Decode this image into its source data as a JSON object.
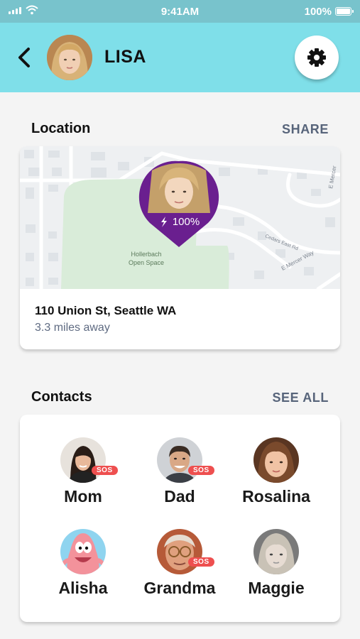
{
  "status_bar": {
    "time": "9:41AM",
    "battery": "100%"
  },
  "header": {
    "name": "LISA",
    "back_icon": "chevron-left-icon",
    "settings_icon": "gear-icon"
  },
  "location": {
    "title": "Location",
    "action": "SHARE",
    "map": {
      "battery_level": "100%",
      "park_name_line1": "Hollerbach",
      "park_name_line2": "Open Space",
      "street_1": "Cedars East Rd",
      "street_2": "E Mercer Way",
      "street_3": "E Mercer"
    },
    "address": "110 Union St, Seattle WA",
    "distance": "3.3 miles away"
  },
  "contacts": {
    "title": "Contacts",
    "action": "SEE ALL",
    "items": [
      {
        "name": "Mom",
        "sos": "SOS"
      },
      {
        "name": "Dad",
        "sos": "SOS"
      },
      {
        "name": "Rosalina"
      },
      {
        "name": "Alisha"
      },
      {
        "name": "Grandma",
        "sos": "SOS"
      },
      {
        "name": "Maggie"
      }
    ]
  },
  "colors": {
    "header": "#7fdfe9",
    "status_bar": "#78c3cc",
    "pin": "#6a1f8f",
    "sos": "#ee4f4f",
    "park": "#d9ecd9",
    "action_text": "#57647a"
  }
}
